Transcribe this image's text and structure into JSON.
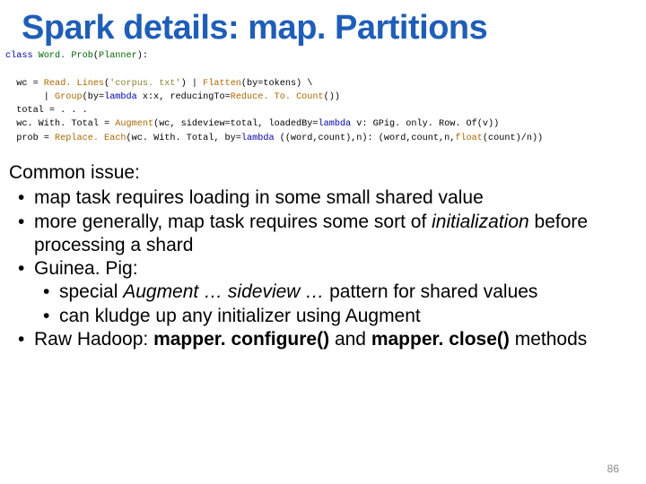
{
  "title": "Spark details: map. Partitions",
  "code": {
    "l1": {
      "kw": "class",
      "sp": " ",
      "name": "Word. Prob",
      "open": "(",
      "arg": "Planner",
      "close": "):"
    },
    "l2": "",
    "l3": {
      "pre": "  wc = ",
      "fn": "Read. Lines",
      "open": "(",
      "str": "'corpus. txt'",
      "close": ") | ",
      "fn2": "Flatten",
      "args2": "(by=tokens) \\"
    },
    "l4": {
      "pre": "       | ",
      "fn": "Group",
      "open": "(by=",
      "kw": "lambda",
      "mid": " x:x, reducingTo=",
      "fn2": "Reduce. To. Count",
      "close": "())"
    },
    "l5": "  total = . . .",
    "l6": {
      "pre": "  wc. With. Total = ",
      "fn": "Augment",
      "open": "(wc, sideview=total, loadedBy=",
      "kw": "lambda",
      "mid": " v: GPig. only. Row. Of(v))"
    },
    "l7": {
      "pre": "  prob = ",
      "fn": "Replace. Each",
      "open": "(wc. With. Total, by=",
      "kw": "lambda",
      "mid": " ((word,count),n): (word,count,n,",
      "fn2": "float",
      "close": "(count)/n))"
    }
  },
  "body": {
    "heading": "Common issue:",
    "b1a": "map task requires loading in some small shared value",
    "b2a": "more generally, map task requires some sort of ",
    "b2b": "initialization",
    "b2c": " before processing a shard",
    "b3a": "Guinea. Pig:",
    "b3_1a": "special ",
    "b3_1b": "Augment … sideview …",
    "b3_1c": " pattern for shared values",
    "b3_2a": "can kludge up any initializer using Augment",
    "b4a": "Raw Hadoop:  ",
    "b4b": "mapper. configure()",
    "b4c": " and ",
    "b4d": "mapper. close()",
    "b4e": " methods"
  },
  "page": "86"
}
